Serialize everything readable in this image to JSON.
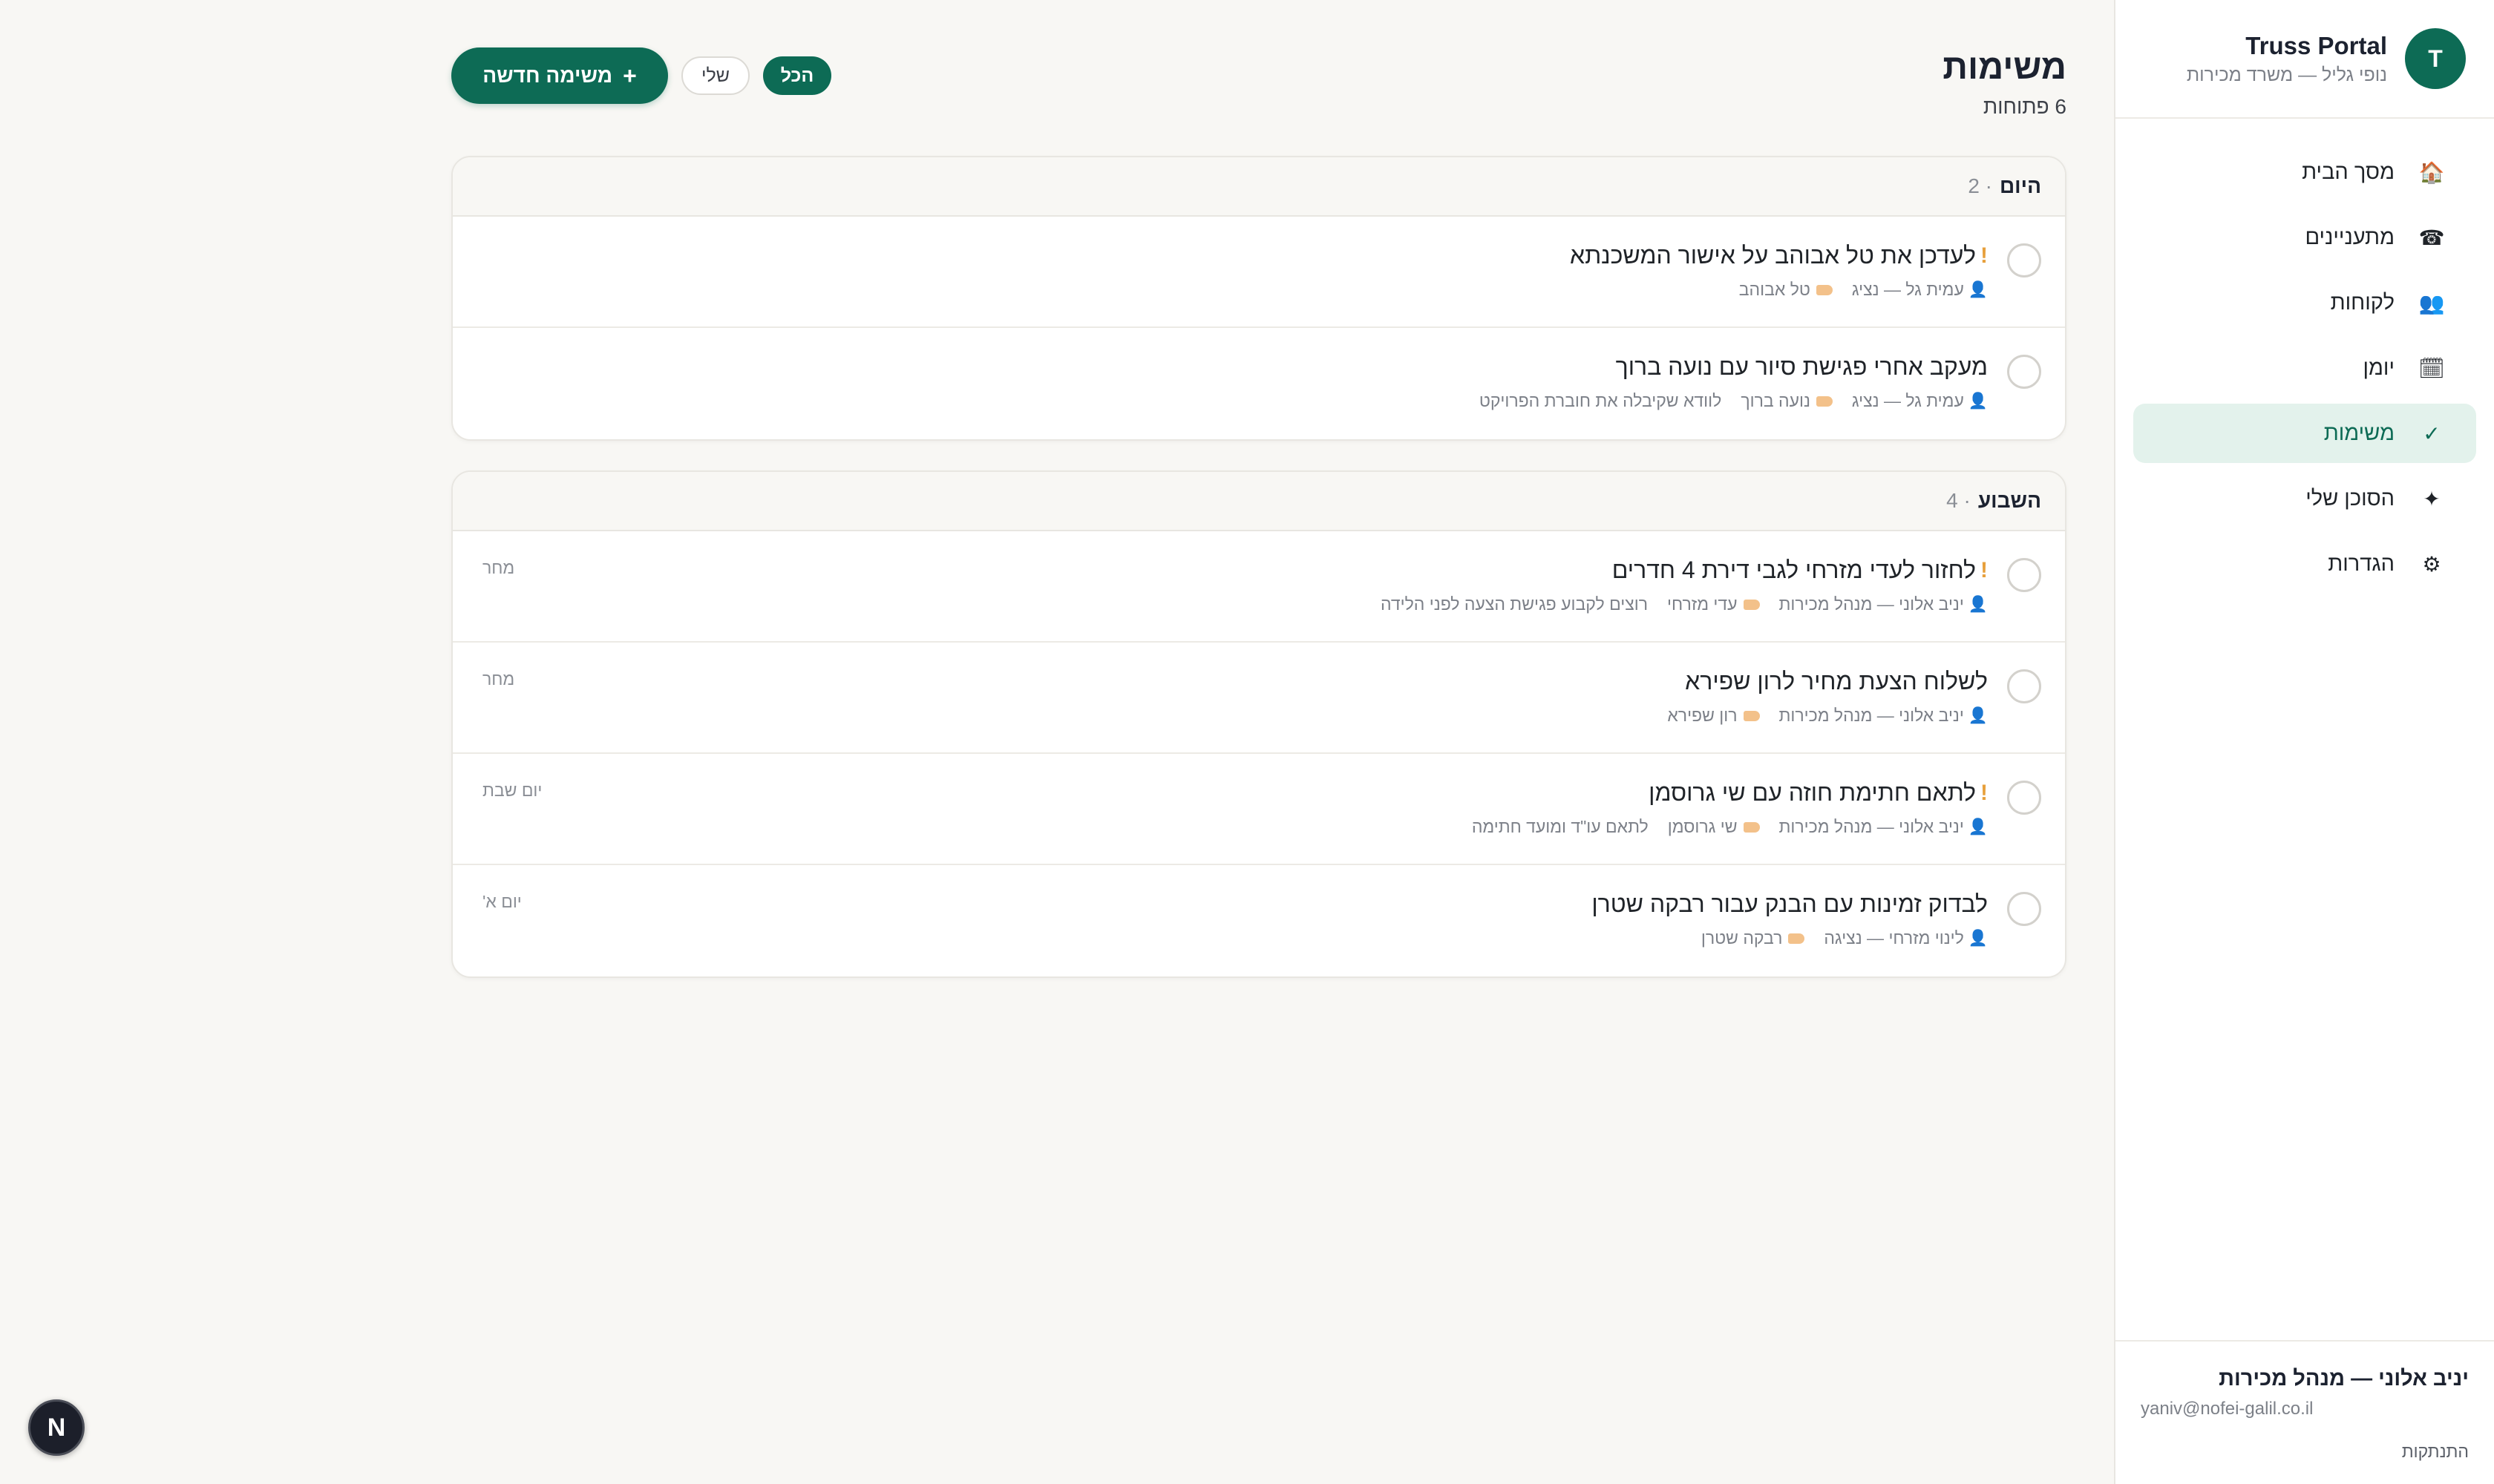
{
  "brand": {
    "avatar_letter": "T",
    "name": "Truss Portal",
    "subtitle": "נופי גליל — משרד מכירות"
  },
  "nav": [
    {
      "icon": "home-icon",
      "glyph": "🏠",
      "label": "מסך הבית"
    },
    {
      "icon": "phone-icon",
      "glyph": "☎",
      "label": "מתעניינים"
    },
    {
      "icon": "people-icon",
      "glyph": "👥",
      "label": "לקוחות"
    },
    {
      "icon": "calendar-icon",
      "glyph": "🗓",
      "label": "יומן"
    },
    {
      "icon": "check-icon",
      "glyph": "✓",
      "label": "משימות",
      "active": true
    },
    {
      "icon": "sparkle-icon",
      "glyph": "✦",
      "label": "הסוכן שלי"
    },
    {
      "icon": "gear-icon",
      "glyph": "⚙",
      "label": "הגדרות"
    }
  ],
  "user": {
    "name": "יניב אלוני — מנהל מכירות",
    "email": "yaniv@nofei-galil.co.il",
    "logout_label": "התנתקות"
  },
  "header": {
    "title": "משימות",
    "subtitle": "6 פתוחות",
    "new_task_label": "משימה חדשה",
    "new_task_plus": "+",
    "filters": {
      "all": "הכל",
      "mine": "שלי"
    }
  },
  "groups": [
    {
      "title": "היום",
      "count": "· 2",
      "tasks": [
        {
          "priority": "!",
          "title": "לעדכן את טל אבוהב על אישור המשכנתא",
          "assignee": "עמית גל — נציג",
          "contact": "טל אבוהב",
          "note": "",
          "due": ""
        },
        {
          "priority": "",
          "title": "מעקב אחרי פגישת סיור עם נועה ברוך",
          "assignee": "עמית גל — נציג",
          "contact": "נועה ברוך",
          "note": "לוודא שקיבלה את חוברת הפרויקט",
          "due": ""
        }
      ]
    },
    {
      "title": "השבוע",
      "count": "· 4",
      "tasks": [
        {
          "priority": "!",
          "title": "לחזור לעדי מזרחי לגבי דירת 4 חדרים",
          "assignee": "יניב אלוני — מנהל מכירות",
          "contact": "עדי מזרחי",
          "note": "רוצים לקבוע פגישת הצעה לפני הלידה",
          "due": "מחר"
        },
        {
          "priority": "",
          "title": "לשלוח הצעת מחיר לרון שפירא",
          "assignee": "יניב אלוני — מנהל מכירות",
          "contact": "רון שפירא",
          "note": "",
          "due": "מחר"
        },
        {
          "priority": "!",
          "title": "לתאם חתימת חוזה עם שי גרוסמן",
          "assignee": "יניב אלוני — מנהל מכירות",
          "contact": "שי גרוסמן",
          "note": "לתאם עו\"ד ומועד חתימה",
          "due": "יום שבת"
        },
        {
          "priority": "",
          "title": "לבדוק זמינות עם הבנק עבור רבקה שטרן",
          "assignee": "לינוי מזרחי — נציגה",
          "contact": "רבקה שטרן",
          "note": "",
          "due": "יום א'"
        }
      ]
    }
  ],
  "dev_badge": "N",
  "colors": {
    "accent": "#0d6b55",
    "accent_light": "#e3f2ec",
    "priority": "#e7a03c",
    "background": "#f8f7f4"
  }
}
